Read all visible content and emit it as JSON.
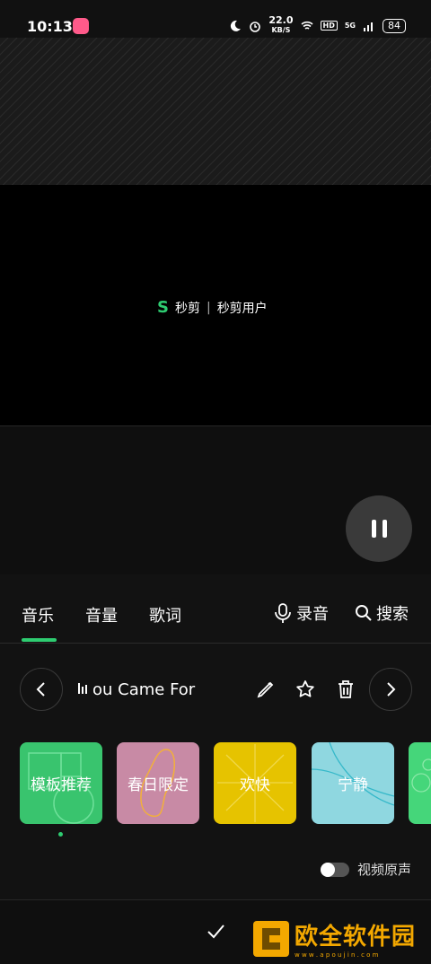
{
  "status_bar": {
    "time": "10:13",
    "speed_value": "22.0",
    "speed_unit": "KB/S",
    "hd": "HD",
    "network": "5G",
    "battery": "84"
  },
  "video": {
    "watermark_brand": "秒剪",
    "watermark_separator": "|",
    "watermark_user": "秒剪用户"
  },
  "tabs": {
    "music": "音乐",
    "volume": "音量",
    "lyrics": "歌词",
    "record": "录音",
    "search": "搜索"
  },
  "music_row": {
    "song_title": "ou Came For"
  },
  "categories": [
    {
      "label": "模板推荐",
      "color": "#39c46e"
    },
    {
      "label": "春日限定",
      "color": "#c88aa5"
    },
    {
      "label": "欢快",
      "color": "#e6c300"
    },
    {
      "label": "宁静",
      "color": "#8fd7e0"
    },
    {
      "label": "",
      "color": "#45d67a"
    }
  ],
  "toggle": {
    "label": "视频原声"
  },
  "site_watermark": {
    "text": "欧全软件园",
    "sub": "w w w . a p o u j i n . c o m"
  },
  "colors": {
    "accent": "#2ecc71",
    "panel_bg": "#121212"
  }
}
